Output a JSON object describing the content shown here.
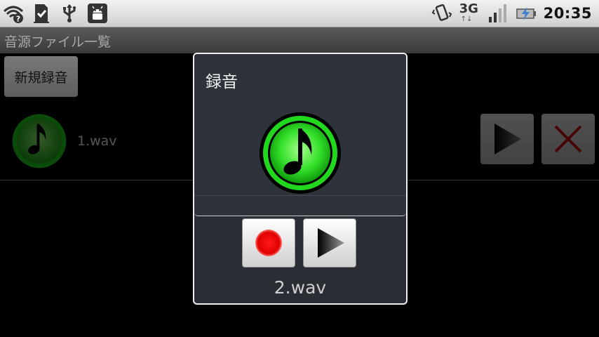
{
  "status_bar": {
    "network_type": "3G",
    "network_arrows": "↑↓",
    "time": "20:35"
  },
  "title_bar": {
    "title": "音源ファイル一覧"
  },
  "toolbar": {
    "new_recording_label": "新規録音"
  },
  "file_list": [
    {
      "name": "1.wav",
      "icon": "music-note-icon"
    }
  ],
  "dialog": {
    "title": "録音",
    "file_name": "2.wav",
    "record_icon": "record-icon",
    "play_icon": "play-icon"
  },
  "colors": {
    "accent_green": "#22d81e",
    "record_red": "#e00000",
    "delete_red": "#cc1111",
    "dialog_bg": "#2e323b"
  }
}
